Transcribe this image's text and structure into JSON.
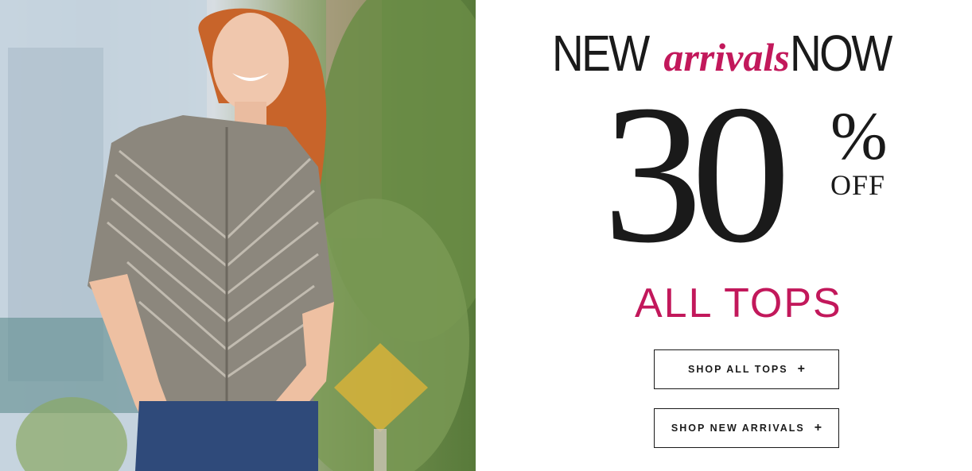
{
  "promo": {
    "headline_new": "NEW",
    "headline_arrivals": "arrivals",
    "headline_now": "NOW",
    "discount_number": "30",
    "discount_percent": "%",
    "discount_off": "OFF",
    "subhead": "ALL TOPS",
    "buttons": [
      {
        "label": "SHOP ALL TOPS",
        "icon": "plus-icon",
        "icon_glyph": "+"
      },
      {
        "label": "SHOP NEW ARRIVALS",
        "icon": "plus-icon",
        "icon_glyph": "+"
      }
    ]
  },
  "colors": {
    "accent": "#c2185b",
    "text": "#1a1a1a",
    "background": "#ffffff"
  }
}
